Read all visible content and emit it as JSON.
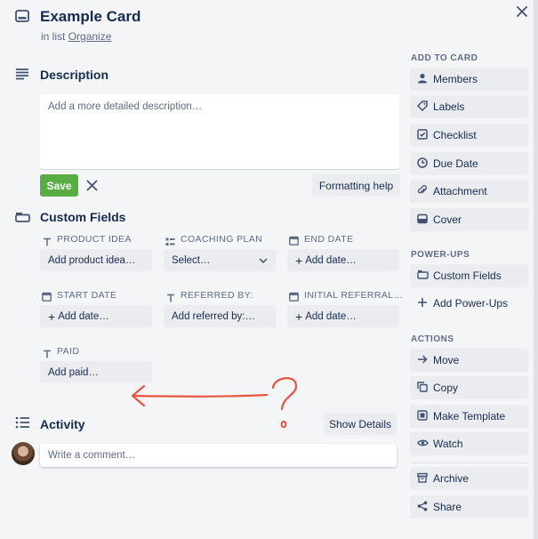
{
  "card": {
    "title": "Example Card",
    "in_list_prefix": "in list",
    "list_name": "Organize"
  },
  "description": {
    "heading": "Description",
    "placeholder": "Add a more detailed description…",
    "save_label": "Save",
    "formatting_help": "Formatting help"
  },
  "custom_fields": {
    "heading": "Custom Fields",
    "fields": [
      {
        "label": "PRODUCT IDEA",
        "value": "Add product idea…",
        "icon": "text-icon"
      },
      {
        "label": "COACHING PLAN",
        "value": "Select…",
        "icon": "dropdown-list-icon"
      },
      {
        "label": "END DATE",
        "value": "Add date…",
        "icon": "calendar-icon"
      },
      {
        "label": "START DATE",
        "value": "Add date…",
        "icon": "calendar-icon"
      },
      {
        "label": "REFERRED BY:",
        "value": "Add referred by:…",
        "icon": "text-icon"
      },
      {
        "label": "INITIAL REFERRAL…",
        "value": "Add date…",
        "icon": "calendar-icon"
      },
      {
        "label": "PAID",
        "value": "Add paid…",
        "icon": "text-icon"
      }
    ]
  },
  "activity": {
    "heading": "Activity",
    "show_details": "Show Details",
    "comment_placeholder": "Write a comment…"
  },
  "sidebar": {
    "add_to_card": {
      "heading": "ADD TO CARD",
      "items": [
        "Members",
        "Labels",
        "Checklist",
        "Due Date",
        "Attachment",
        "Cover"
      ]
    },
    "power_ups": {
      "heading": "POWER-UPS",
      "items": [
        "Custom Fields",
        "Add Power-Ups"
      ]
    },
    "actions": {
      "heading": "ACTIONS",
      "items": [
        "Move",
        "Copy",
        "Make Template",
        "Watch",
        "Archive",
        "Share"
      ]
    }
  },
  "colors": {
    "save_green": "#5aac44",
    "annotation_red": "#e8553e",
    "background": "#f4f5f7"
  }
}
